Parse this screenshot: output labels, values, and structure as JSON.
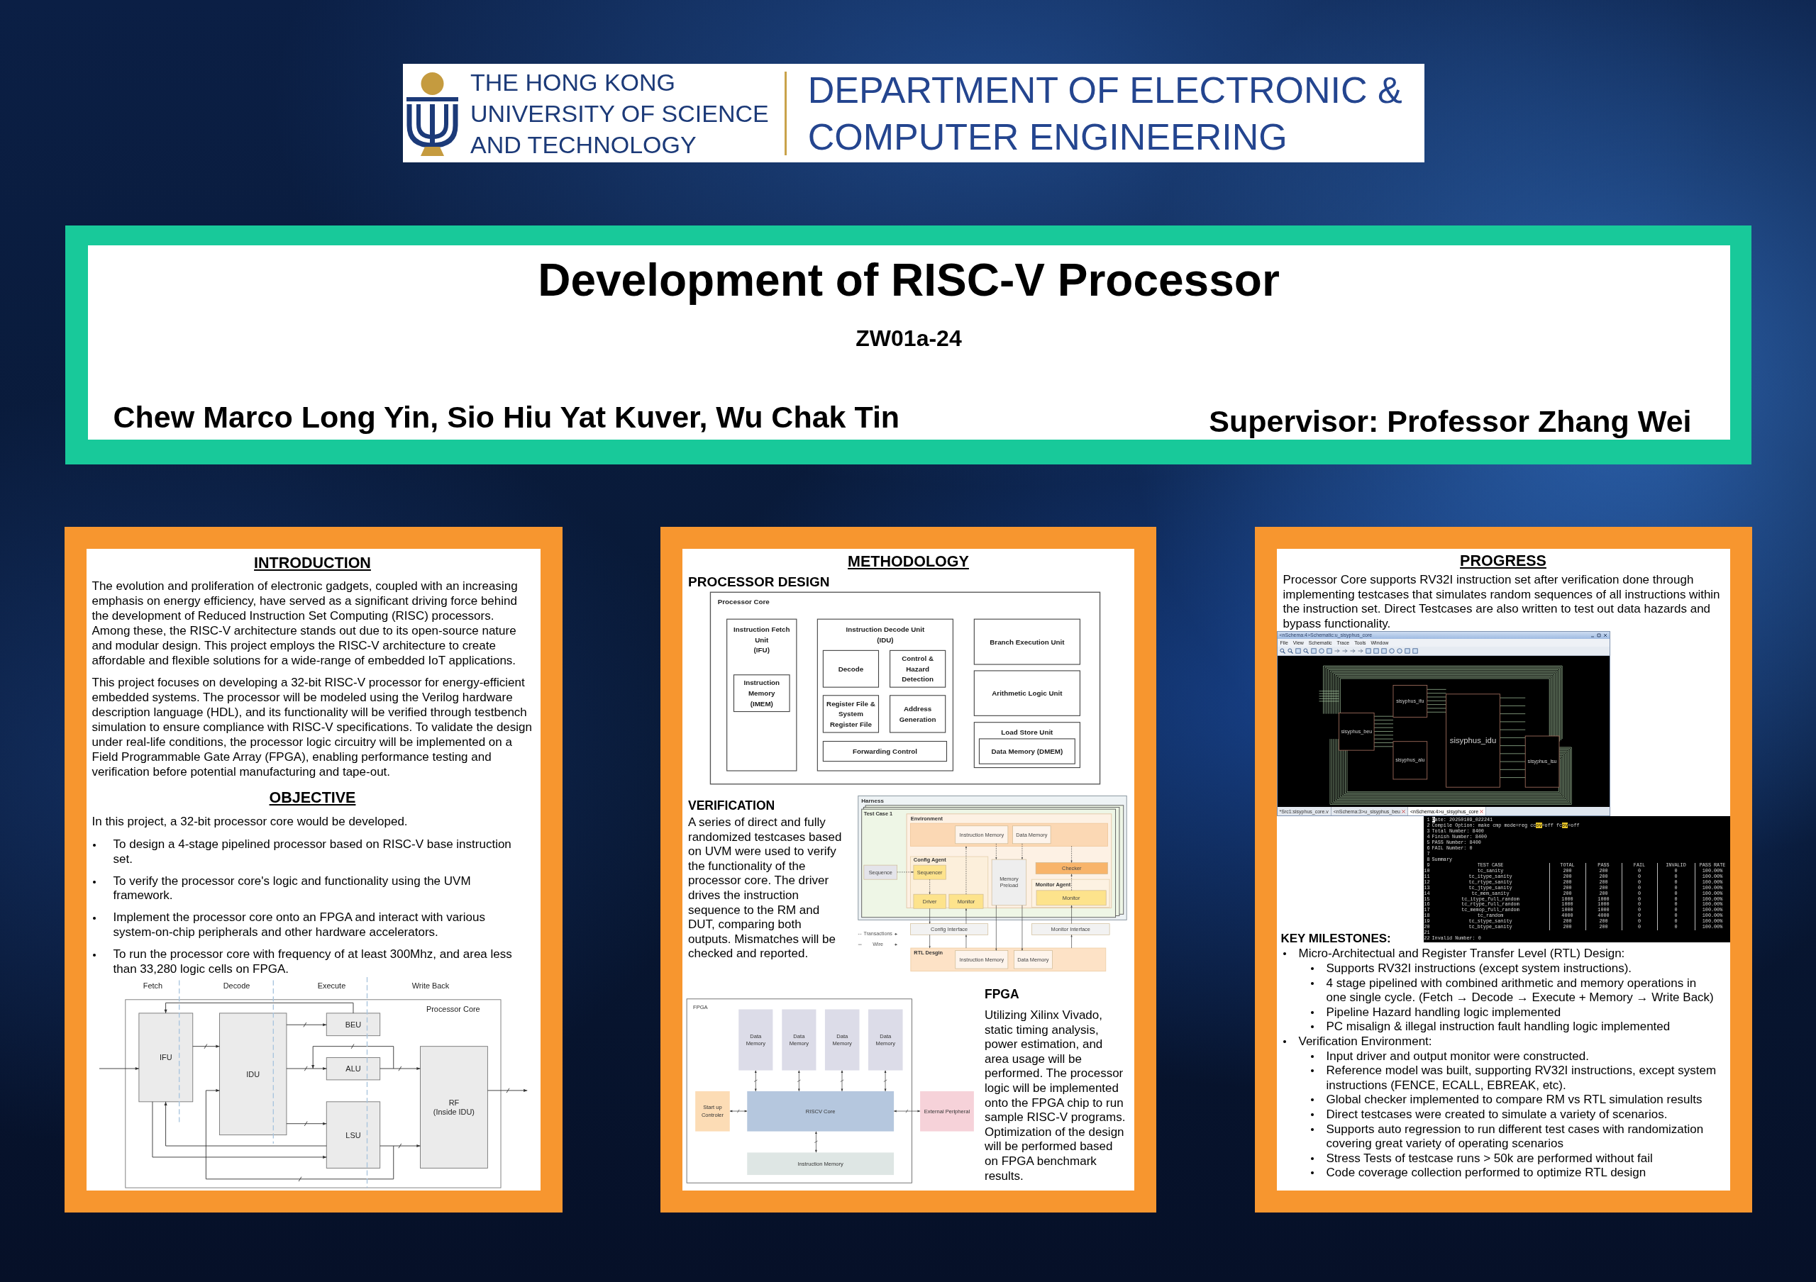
{
  "header": {
    "university_name": [
      "THE HONG KONG",
      "UNIVERSITY OF SCIENCE",
      "AND TECHNOLOGY"
    ],
    "department": [
      "DEPARTMENT OF ELECTRONIC &",
      "COMPUTER ENGINEERING"
    ]
  },
  "title_box": {
    "title": "Development of RISC-V Processor",
    "project_code": "ZW01a-24",
    "authors": "Chew Marco Long Yin, Sio Hiu Yat Kuver, Wu Chak Tin",
    "supervisor": "Supervisor: Professor Zhang Wei"
  },
  "introduction": {
    "heading": "INTRODUCTION",
    "paragraphs": [
      "The evolution and proliferation of electronic gadgets, coupled with an increasing emphasis on energy efficiency, have served as a significant driving force behind the development of Reduced Instruction Set Computing (RISC) processors. Among these, the RISC-V architecture stands out due to its open-source nature and modular design. This project employs the RISC-V architecture to create affordable and flexible solutions for a wide-range of embedded IoT applications.",
      "This project focuses on developing a 32-bit RISC-V processor for energy-efficient embedded systems. The processor will be modeled using the Verilog hardware description language (HDL), and its functionality will be verified through testbench simulation to ensure compliance with RISC-V specifications. To validate the design under real-life conditions, the processor logic circuitry will be implemented on a Field Programmable Gate Array (FPGA), enabling performance testing and verification before potential manufacturing and tape-out."
    ]
  },
  "objective": {
    "heading": "OBJECTIVE",
    "lead": "In this project, a 32-bit processor core would be developed.",
    "items": [
      "To design a 4-stage pipelined processor based on RISC-V base instruction set.",
      "To verify the processor core's logic and functionality using the UVM framework.",
      "Implement the processor core onto an FPGA and interact with various system-on-chip peripherals and other hardware accelerators.",
      "To run the processor core with frequency of at least 300Mhz, and area less than 33,280 logic cells on FPGA."
    ]
  },
  "pipeline_diagram": {
    "stages": [
      "Fetch",
      "Decode",
      "Execute",
      "Write Back"
    ],
    "container": "Processor Core",
    "blocks": [
      {
        "lines": [
          "IFU"
        ]
      },
      {
        "lines": [
          "IDU"
        ]
      },
      {
        "lines": [
          "BEU"
        ]
      },
      {
        "lines": [
          "ALU"
        ]
      },
      {
        "lines": [
          "LSU"
        ]
      },
      {
        "lines": [
          "RF",
          "(Inside IDU)"
        ]
      }
    ]
  },
  "methodology": {
    "heading": "METHODOLOGY",
    "processor_design": {
      "heading": "PROCESSOR DESIGN",
      "container": "Processor Core",
      "units": [
        {
          "lines": [
            "Instruction Fetch",
            "Unit",
            "(IFU)"
          ],
          "children": [
            {
              "lines": [
                "Instruction",
                "Memory",
                "(IMEM)"
              ]
            }
          ]
        },
        {
          "lines": [
            "Instruction Decode Unit",
            "(IDU)"
          ],
          "children": [
            {
              "lines": [
                "Decode"
              ]
            },
            {
              "lines": [
                "Control &",
                "Hazard",
                "Detection"
              ]
            },
            {
              "lines": [
                "Register File &",
                "System",
                "Register File"
              ]
            },
            {
              "lines": [
                "Address",
                "Generation"
              ]
            },
            {
              "lines": [
                "Forwarding Control"
              ]
            }
          ]
        },
        {
          "lines": [
            "Branch Execution Unit"
          ]
        },
        {
          "lines": [
            "Arithmetic Logic Unit"
          ]
        },
        {
          "lines": [
            "Load Store Unit"
          ],
          "children": [
            {
              "lines": [
                "Data Memory (DMEM)"
              ]
            }
          ]
        }
      ]
    },
    "verification": {
      "heading": "VERIFICATION",
      "text": "A series of direct and fully randomized testcases based on UVM were used to verify the functionality of the processor core. The driver drives the instruction sequence to the RM and DUT, comparing both outputs. Mismatches will be checked and reported.",
      "diagram": {
        "regions": [
          {
            "label": "Harness",
            "color": "#eef3f5",
            "children": [
              {
                "label": "Test Case 1",
                "color": "#eef6e6",
                "blocks": [
                  {
                    "lines": [
                      "Sequence"
                    ],
                    "color": "#e4e4ea"
                  }
                ],
                "children": [
                  {
                    "label": "Environment",
                    "color": "#fdf1e4",
                    "blocks": [
                      {
                        "lines": [
                          "Memory",
                          "Preload"
                        ],
                        "color": "#eeeeee"
                      },
                      {
                        "lines": [
                          "Checker"
                        ],
                        "color": "#f8b46a"
                      }
                    ],
                    "children": [
                      {
                        "color": "#fbd8b4",
                        "blocks": [
                          {
                            "lines": [
                              "Instruction Memory"
                            ],
                            "color": "#fdf4ec"
                          },
                          {
                            "lines": [
                              "Data Memory"
                            ],
                            "color": "#fdf4ec"
                          }
                        ]
                      },
                      {
                        "label": "Config Agent",
                        "color": "#fcefdb",
                        "blocks": [
                          {
                            "lines": [
                              "Sequencer"
                            ],
                            "color": "#fde38c"
                          },
                          {
                            "lines": [
                              "Driver"
                            ],
                            "color": "#fde38c"
                          },
                          {
                            "lines": [
                              "Monitor"
                            ],
                            "color": "#fde38c"
                          }
                        ]
                      },
                      {
                        "label": "Monitor Agent",
                        "color": "#fdf2e2",
                        "blocks": [
                          {
                            "lines": [
                              "Monitor"
                            ],
                            "color": "#fde38c"
                          }
                        ]
                      }
                    ]
                  }
                ]
              }
            ]
          },
          {
            "label": "RTL Desgin",
            "color": "#fde2c6",
            "blocks": [
              {
                "lines": [
                  "Instruction Memory"
                ],
                "color": "#fdf4ec"
              },
              {
                "lines": [
                  "Data Memory"
                ],
                "color": "#fdf4ec"
              }
            ]
          }
        ],
        "blocks": [
          {
            "lines": [
              "Config Interface"
            ],
            "color": "#f2f2f2"
          },
          {
            "lines": [
              "Monitor Interface"
            ],
            "color": "#f2f2f2"
          }
        ],
        "legend": [
          {
            "label": "Transactions",
            "kind": "dashed"
          },
          {
            "label": "Wire",
            "kind": "solid"
          }
        ]
      }
    },
    "fpga": {
      "heading": "FPGA",
      "text": "Utilizing Xilinx Vivado, static timing analysis, power estimation, and area usage will be performed. The processor logic will be implemented onto the FPGA chip to run sample RISC-V programs. Optimization of the design will be performed based on FPGA benchmark results.",
      "diagram": {
        "container": "FPGA",
        "blocks": [
          {
            "lines": [
              "Data",
              "Memory"
            ],
            "color": "#dcdce8"
          },
          {
            "lines": [
              "Data",
              "Memory"
            ],
            "color": "#dcdce8"
          },
          {
            "lines": [
              "Data",
              "Memory"
            ],
            "color": "#dcdce8"
          },
          {
            "lines": [
              "Data",
              "Memory"
            ],
            "color": "#dcdce8"
          },
          {
            "lines": [
              "Start up",
              "Controler"
            ],
            "color": "#fcdcb5"
          },
          {
            "lines": [
              "RISCV Core"
            ],
            "color": "#b5c7de"
          },
          {
            "lines": [
              "External Peripheral"
            ],
            "color": "#f6d2d9"
          },
          {
            "lines": [
              "Instruction Memory"
            ],
            "color": "#dee6e4"
          }
        ]
      }
    }
  },
  "progress": {
    "heading": "PROGRESS",
    "text": "Processor Core supports RV32I instruction set after verification done through implementing testcases that simulates random sequences of all instructions within the instruction set. Direct Testcases are also written to test out data hazards and bypass functionality.",
    "schematic_window": {
      "title": "<nSchema:4>Schematic:u_sisyphus_core",
      "menu": [
        "File",
        "View",
        "Schematic",
        "Trace",
        "Tools",
        "Window"
      ],
      "blocks": [
        "sisyphus_ifu",
        "sisyphus_beu",
        "sisyphus_alu",
        "sisyphus_idu",
        "sisyphus_lsu"
      ],
      "tabs": [
        {
          "label": "*Src1:sisyphus_core.v",
          "selected": false,
          "closable": false
        },
        {
          "label": "<nSchema:3>u_sisyphus_beu",
          "selected": false,
          "closable": true
        },
        {
          "label": "<nSchema:4>u_sisyphus_core",
          "selected": true,
          "closable": true
        }
      ]
    },
    "terminal": {
      "lines": [
        {
          "number": "1",
          "kind": "text",
          "segments": [
            {
              "text": "D",
              "kind": "cursor"
            },
            {
              "text": "ate: 20250109_022241",
              "kind": "plain"
            }
          ]
        },
        {
          "number": "2",
          "kind": "text",
          "segments": [
            {
              "text": "Compile Option: make cmp mode=reg cc",
              "kind": "plain"
            },
            {
              "text": "ov",
              "kind": "match"
            },
            {
              "text": "=off fc",
              "kind": "plain"
            },
            {
              "text": "ov",
              "kind": "match"
            },
            {
              "text": "=off",
              "kind": "plain"
            }
          ]
        },
        {
          "number": "3",
          "kind": "text",
          "segments": [
            {
              "text": "Total Number: 8400",
              "kind": "plain"
            }
          ]
        },
        {
          "number": "4",
          "kind": "text",
          "segments": [
            {
              "text": "Finish Number: 8400",
              "kind": "plain"
            }
          ]
        },
        {
          "number": "5",
          "kind": "text",
          "segments": [
            {
              "text": "PASS Number: 8400",
              "kind": "plain"
            }
          ]
        },
        {
          "number": "6",
          "kind": "text",
          "segments": [
            {
              "text": "FAIL Number: 0",
              "kind": "plain"
            }
          ]
        },
        {
          "number": "7",
          "kind": "blank"
        },
        {
          "number": "8",
          "kind": "text",
          "segments": [
            {
              "text": "Summary",
              "kind": "plain"
            }
          ]
        },
        {
          "number": "9",
          "kind": "row",
          "cells": [
            "TEST CASE",
            "TOTAL",
            "PASS",
            "FAIL",
            "INVALID",
            "PASS RATE"
          ]
        },
        {
          "number": "10",
          "kind": "row",
          "cells": [
            "tc_sanity",
            "200",
            "200",
            "0",
            "0",
            "100.00%"
          ]
        },
        {
          "number": "11",
          "kind": "row",
          "cells": [
            "tc_itype_sanity",
            "200",
            "200",
            "0",
            "0",
            "100.00%"
          ]
        },
        {
          "number": "12",
          "kind": "row",
          "cells": [
            "tc_rtype_sanity",
            "200",
            "200",
            "0",
            "0",
            "100.00%"
          ]
        },
        {
          "number": "13",
          "kind": "row",
          "cells": [
            "tc_jtype_sanity",
            "200",
            "200",
            "0",
            "0",
            "100.00%"
          ]
        },
        {
          "number": "14",
          "kind": "row",
          "cells": [
            "tc_mem_sanity",
            "200",
            "200",
            "0",
            "0",
            "100.00%"
          ]
        },
        {
          "number": "15",
          "kind": "row",
          "cells": [
            "tc_itype_full_random",
            "1000",
            "1000",
            "0",
            "0",
            "100.00%"
          ]
        },
        {
          "number": "16",
          "kind": "row",
          "cells": [
            "tc_rtype_full_random",
            "1000",
            "1000",
            "0",
            "0",
            "100.00%"
          ]
        },
        {
          "number": "17",
          "kind": "row",
          "cells": [
            "tc_memop_full_random",
            "1000",
            "1000",
            "0",
            "0",
            "100.00%"
          ]
        },
        {
          "number": "18",
          "kind": "row",
          "cells": [
            "tc_random",
            "4000",
            "4000",
            "0",
            "0",
            "100.00%"
          ]
        },
        {
          "number": "19",
          "kind": "row",
          "cells": [
            "tc_stype_sanity",
            "200",
            "200",
            "0",
            "0",
            "100.00%"
          ]
        },
        {
          "number": "20",
          "kind": "row",
          "cells": [
            "tc_btype_sanity",
            "200",
            "200",
            "0",
            "0",
            "100.00%"
          ]
        },
        {
          "number": "21",
          "kind": "blank"
        },
        {
          "number": "22",
          "kind": "text",
          "segments": [
            {
              "text": "Invalid Number: 0",
              "kind": "plain"
            }
          ]
        }
      ]
    },
    "milestones": {
      "heading": "KEY MILESTONES:",
      "items": [
        {
          "text": "Micro-Architectual and Register Transfer Level (RTL) Design:",
          "children": [
            {
              "text": "Supports RV32I instructions (except system instructions)."
            },
            {
              "text": "4 stage pipelined with combined arithmetic and memory operations in one single cycle. (Fetch → Decode → Execute + Memory → Write Back)"
            },
            {
              "text": "Pipeline Hazard handling logic implemented"
            },
            {
              "text": "PC misalign & illegal instruction fault handling logic implemented"
            }
          ]
        },
        {
          "text": "Verification Environment:",
          "children": [
            {
              "text": "Input driver and output monitor were constructed."
            },
            {
              "text": "Reference model was built, supporting RV32I instructions, except system instructions (FENCE, ECALL, EBREAK, etc)."
            },
            {
              "text": "Global checker implemented to compare RM vs RTL simulation results"
            },
            {
              "text": "Direct testcases were created to simulate a variety of scenarios."
            },
            {
              "text": "Supports auto regression to run different test cases with randomization covering great variety of operating scenarios"
            },
            {
              "text": "Stress Tests of testcase runs > 50k are performed without fail"
            },
            {
              "text": "Code coverage collection performed to optimize RTL design"
            }
          ]
        }
      ]
    }
  }
}
